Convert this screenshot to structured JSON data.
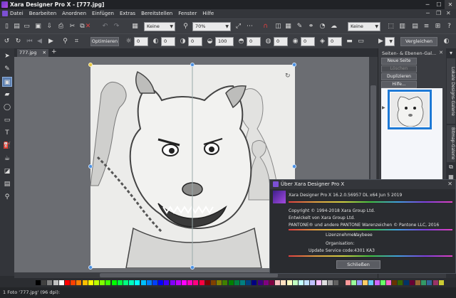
{
  "window": {
    "title": "Xara Designer Pro X - [777.jpg]",
    "controls": {
      "minimize": "─",
      "maximize": "☐",
      "close": "✕"
    }
  },
  "menu": {
    "items": [
      "Datei",
      "Bearbeiten",
      "Anordnen",
      "Einfügen",
      "Extras",
      "Bereitstellen",
      "Fenster",
      "Hilfe"
    ]
  },
  "toolbar1": {
    "fill_select": "Keine",
    "zoom_select": "70%",
    "right_select": "Keine"
  },
  "toolbar2": {
    "optimize_button": "Optimieren",
    "value1": "0",
    "value2": "0",
    "value3": "0",
    "value4": "100",
    "value5": "0",
    "value6": "0",
    "value7": "0",
    "value8": "0",
    "compare_button": "Vergleichen"
  },
  "document": {
    "tab_label": "777.jpg"
  },
  "gallery": {
    "title": "Seiten- & Ebenen-Gal...",
    "buttons": {
      "new_page": "Neue Seite",
      "delete": "Löschen",
      "duplicate": "Duplizieren",
      "help": "Hilfe..."
    },
    "page_marker": "▶"
  },
  "side_tabs": {
    "tab1": "Lokale Designs-Galerie",
    "tab2": "Bitmap-Galerie"
  },
  "about_dialog": {
    "title": "Über Xara Designer Pro X",
    "version": "Xara Designer Pro X 16.2.0.56957  DL x64 Jun  5 2019",
    "copyright1": "Copyright © 1994-2018 Xara Group Ltd.",
    "developer": "Entwickelt von Xara Group Ltd.",
    "pantone": "PANTONE® und andere PANTONE Warenzeichen © Pantone LLC, 2016",
    "licensee_label": "Lizenznehmer:",
    "licensee_value": "Vaybeee",
    "org_label": "Organisation:",
    "update_label": "Update Service code:",
    "update_value": "4301 KA3",
    "close_button": "Schließen"
  },
  "status": {
    "text": "1 Foto '777.jpg' (96 dpi):"
  },
  "colors": {
    "accent": "#1d79d6",
    "handle": "#4a90e2",
    "palette": [
      "#000000",
      "#404040",
      "#808080",
      "#c0c0c0",
      "#ffffff",
      "#ff0000",
      "#ff4000",
      "#ff8000",
      "#ffbf00",
      "#ffff00",
      "#bfff00",
      "#80ff00",
      "#40ff00",
      "#00ff00",
      "#00ff40",
      "#00ff80",
      "#00ffbf",
      "#00ffff",
      "#00bfff",
      "#0080ff",
      "#0040ff",
      "#0000ff",
      "#4000ff",
      "#8000ff",
      "#bf00ff",
      "#ff00ff",
      "#ff00bf",
      "#ff0080",
      "#ff0040",
      "#800000",
      "#804000",
      "#808000",
      "#408000",
      "#008000",
      "#008040",
      "#008080",
      "#004080",
      "#000080",
      "#400080",
      "#800080",
      "#800040",
      "#ffc0c0",
      "#ffe0c0",
      "#ffffc0",
      "#c0ffc0",
      "#c0ffff",
      "#c0e0ff",
      "#c0c0ff",
      "#ffc0ff",
      "#e0e0e0",
      "#a0a0a0",
      "#606060",
      "#303030",
      "#ff9999",
      "#99ff99",
      "#9999ff",
      "#ffcc66",
      "#66ccff",
      "#cc66ff",
      "#66ff66",
      "#ff66cc",
      "#663300",
      "#336600",
      "#003366",
      "#660033",
      "#996633",
      "#339966",
      "#336699",
      "#993366",
      "#cccc33"
    ]
  }
}
